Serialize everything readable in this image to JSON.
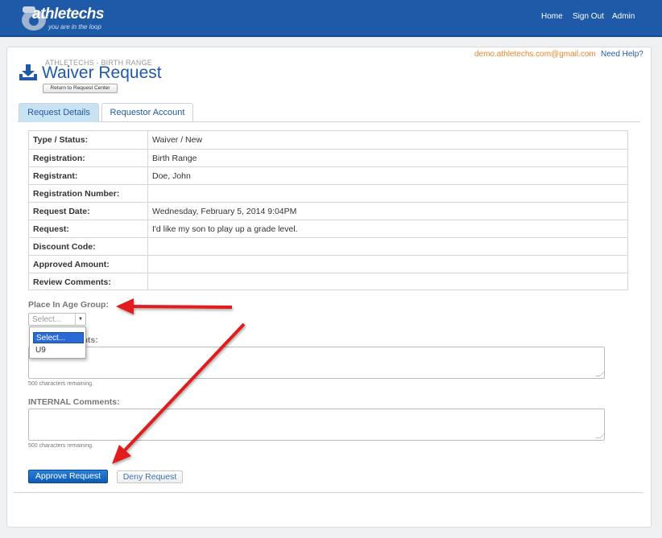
{
  "header": {
    "logo_text": "athletechs",
    "logo_tagline": "you are in the loop",
    "nav": [
      "Home",
      "Sign Out",
      "Admin"
    ]
  },
  "top_links": {
    "email": "demo.athletechs.com@gmail.com",
    "help": "Need Help?"
  },
  "page": {
    "subtitle": "ATHLETECHS - BIRTH RANGE",
    "title": "Waiver Request",
    "return_label": "Return to Request Center"
  },
  "tabs": [
    {
      "label": "Request Details",
      "active": true
    },
    {
      "label": "Requestor Account",
      "active": false
    }
  ],
  "details": [
    {
      "label": "Type / Status:",
      "value": "Waiver / New"
    },
    {
      "label": "Registration:",
      "value": "Birth Range"
    },
    {
      "label": "Registrant:",
      "value": "Doe, John"
    },
    {
      "label": "Registration Number:",
      "value": ""
    },
    {
      "label": "Request Date:",
      "value": "Wednesday, February 5, 2014 9:04PM"
    },
    {
      "label": "Request:",
      "value": "I'd like my son to play up a grade level."
    },
    {
      "label": "Discount Code:",
      "value": ""
    },
    {
      "label": "Approved Amount:",
      "value": ""
    },
    {
      "label": "Review Comments:",
      "value": ""
    }
  ],
  "form": {
    "age_group_label": "Place In Age Group:",
    "select_value": "Select...",
    "options": [
      "Select...",
      "U9"
    ],
    "comments_label_visible": "mments:",
    "chars_remaining": "500 characters remaining.",
    "internal_label": "INTERNAL Comments:",
    "internal_chars_remaining": "500 characters remaining."
  },
  "actions": {
    "approve": "Approve Request",
    "deny": "Deny Request"
  },
  "colors": {
    "brand_blue": "#1f5aa8",
    "accent_orange": "#e9862b",
    "annotation_red": "#e01b1b"
  }
}
